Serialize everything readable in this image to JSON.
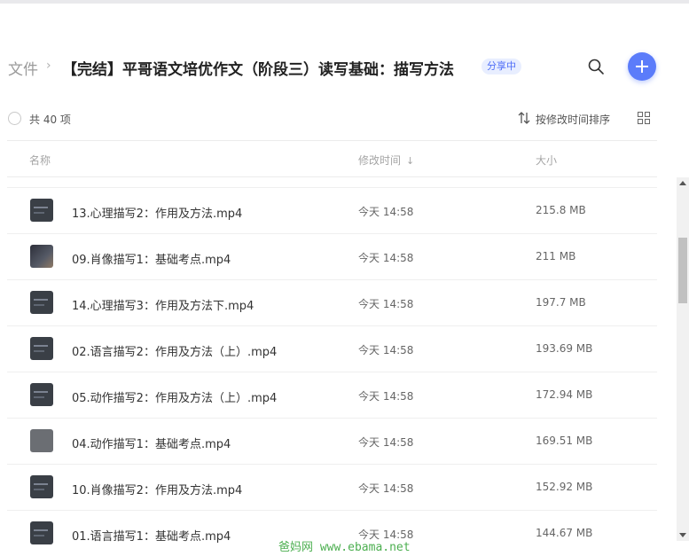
{
  "breadcrumb": {
    "root": "文件",
    "separator": "›",
    "title": "【完结】平哥语文培优作文（阶段三）读写基础：描写方法",
    "share_badge": "分享中"
  },
  "toolbar": {
    "count_label": "共 40 项",
    "sort_label": "按修改时间排序"
  },
  "columns": {
    "name": "名称",
    "mtime": "修改时间",
    "mtime_sort_arrow": "↓",
    "size": "大小"
  },
  "files": [
    {
      "name": "13.心理描写2：作用及方法.mp4",
      "mtime": "今天 14:58",
      "size": "215.8 MB",
      "thumb": "dark"
    },
    {
      "name": "09.肖像描写1：基础考点.mp4",
      "mtime": "今天 14:58",
      "size": "211 MB",
      "thumb": "photo"
    },
    {
      "name": "14.心理描写3：作用及方法下.mp4",
      "mtime": "今天 14:58",
      "size": "197.7 MB",
      "thumb": "dark"
    },
    {
      "name": "02.语言描写2：作用及方法（上）.mp4",
      "mtime": "今天 14:58",
      "size": "193.69 MB",
      "thumb": "dark"
    },
    {
      "name": "05.动作描写2：作用及方法（上）.mp4",
      "mtime": "今天 14:58",
      "size": "172.94 MB",
      "thumb": "dark"
    },
    {
      "name": "04.动作描写1：基础考点.mp4",
      "mtime": "今天 14:58",
      "size": "169.51 MB",
      "thumb": "light"
    },
    {
      "name": "10.肖像描写2：作用及方法.mp4",
      "mtime": "今天 14:58",
      "size": "152.92 MB",
      "thumb": "dark"
    },
    {
      "name": "01.语言描写1：基础考点.mp4",
      "mtime": "今天 14:58",
      "size": "144.67 MB",
      "thumb": "dark"
    }
  ],
  "watermark": "爸妈网 www.ebama.net",
  "colors": {
    "accent": "#5b7cfa",
    "badge_bg": "#e8eeff",
    "badge_text": "#4f6ef7",
    "watermark": "#4caf50"
  }
}
